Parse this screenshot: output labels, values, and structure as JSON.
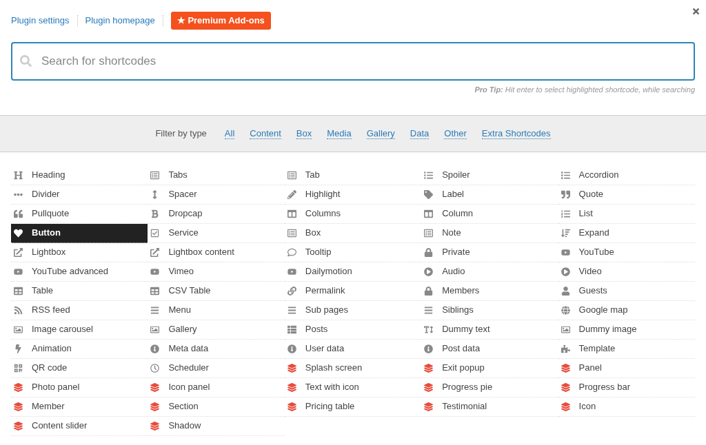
{
  "header": {
    "links": [
      "Plugin settings",
      "Plugin homepage"
    ],
    "premium_button": "★ Premium Add-ons"
  },
  "search": {
    "placeholder": "Search for shortcodes",
    "tip": "**Pro Tip:** Hit enter to select highlighted shortcode, while searching"
  },
  "filter": {
    "label": "Filter by type",
    "types": [
      "All",
      "Content",
      "Box",
      "Media",
      "Gallery",
      "Data",
      "Other",
      "Extra Shortcodes"
    ]
  },
  "shortcodes": [
    {
      "label": "Heading",
      "selected": false
    },
    {
      "label": "Tabs",
      "selected": false
    },
    {
      "label": "Tab",
      "selected": false
    },
    {
      "label": "Spoiler",
      "selected": false
    },
    {
      "label": "Accordion",
      "selected": false
    },
    {
      "label": "Divider",
      "selected": false
    },
    {
      "label": "Spacer",
      "selected": false
    },
    {
      "label": "Highlight",
      "selected": false
    },
    {
      "label": "Label",
      "selected": false
    },
    {
      "label": "Quote",
      "selected": false
    },
    {
      "label": "Pullquote",
      "selected": false
    },
    {
      "label": "Dropcap",
      "selected": false
    },
    {
      "label": "Columns",
      "selected": false
    },
    {
      "label": "Column",
      "selected": false
    },
    {
      "label": "List",
      "selected": false
    },
    {
      "label": "Button",
      "selected": true
    },
    {
      "label": "Service",
      "selected": false
    },
    {
      "label": "Box",
      "selected": false
    },
    {
      "label": "Note",
      "selected": false
    },
    {
      "label": "Expand",
      "selected": false
    },
    {
      "label": "Lightbox",
      "selected": false
    },
    {
      "label": "Lightbox content",
      "selected": false
    },
    {
      "label": "Tooltip",
      "selected": false
    },
    {
      "label": "Private",
      "selected": false
    },
    {
      "label": "YouTube",
      "selected": false
    },
    {
      "label": "YouTube advanced",
      "selected": false
    },
    {
      "label": "Vimeo",
      "selected": false
    },
    {
      "label": "Dailymotion",
      "selected": false
    },
    {
      "label": "Audio",
      "selected": false
    },
    {
      "label": "Video",
      "selected": false
    },
    {
      "label": "Table",
      "selected": false
    },
    {
      "label": "CSV Table",
      "selected": false
    },
    {
      "label": "Permalink",
      "selected": false
    },
    {
      "label": "Members",
      "selected": false
    },
    {
      "label": "Guests",
      "selected": false
    },
    {
      "label": "RSS feed",
      "selected": false
    },
    {
      "label": "Menu",
      "selected": false
    },
    {
      "label": "Sub pages",
      "selected": false
    },
    {
      "label": "Siblings",
      "selected": false
    },
    {
      "label": "Google map",
      "selected": false
    },
    {
      "label": "Image carousel",
      "selected": false
    },
    {
      "label": "Gallery",
      "selected": false
    },
    {
      "label": "Posts",
      "selected": false
    },
    {
      "label": "Dummy text",
      "selected": false
    },
    {
      "label": "Dummy image",
      "selected": false
    },
    {
      "label": "Animation",
      "selected": false
    },
    {
      "label": "Meta data",
      "selected": false
    },
    {
      "label": "User data",
      "selected": false
    },
    {
      "label": "Post data",
      "selected": false
    },
    {
      "label": "Template",
      "selected": false
    },
    {
      "label": "QR code",
      "selected": false
    },
    {
      "label": "Scheduler",
      "selected": false
    },
    {
      "label": "Splash screen",
      "selected": false
    },
    {
      "label": "Exit popup",
      "selected": false
    },
    {
      "label": "Panel",
      "selected": false
    },
    {
      "label": "Photo panel",
      "selected": false
    },
    {
      "label": "Icon panel",
      "selected": false
    },
    {
      "label": "Text with icon",
      "selected": false
    },
    {
      "label": "Progress pie",
      "selected": false
    },
    {
      "label": "Progress bar",
      "selected": false
    },
    {
      "label": "Member",
      "selected": false
    },
    {
      "label": "Section",
      "selected": false
    },
    {
      "label": "Pricing table",
      "selected": false
    },
    {
      "label": "Testimonial",
      "selected": false
    },
    {
      "label": "Icon",
      "selected": false
    },
    {
      "label": "Content slider",
      "selected": false
    },
    {
      "label": "Shadow",
      "selected": false
    }
  ]
}
